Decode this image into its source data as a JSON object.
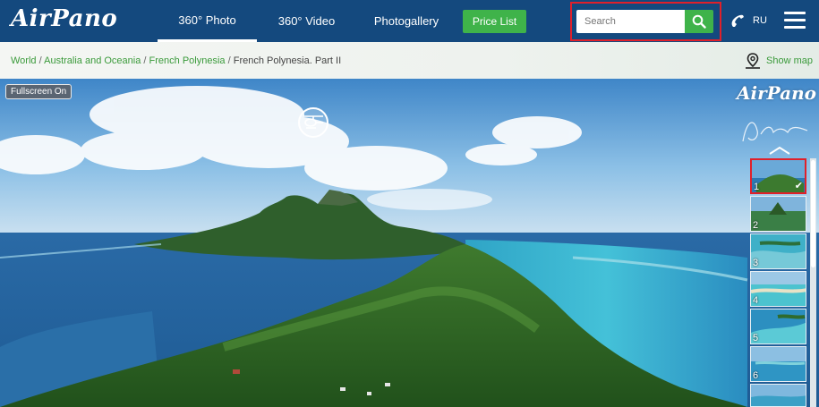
{
  "header": {
    "logo_text": "AirPano",
    "nav": [
      {
        "label": "360° Photo"
      },
      {
        "label": "360° Video"
      },
      {
        "label": "Photogallery"
      }
    ],
    "price_list_label": "Price List",
    "search": {
      "placeholder": "Search",
      "value": ""
    },
    "language": "RU"
  },
  "breadcrumb": {
    "items": [
      {
        "label": "World"
      },
      {
        "label": "Australia and Oceania"
      },
      {
        "label": "French Polynesia"
      },
      {
        "label": "French Polynesia. Part II"
      }
    ],
    "separator": "/",
    "show_map_label": "Show map"
  },
  "panorama": {
    "fullscreen_label": "Fullscreen On",
    "logo_text": "AirPano",
    "thumbnails": [
      {
        "num": "1",
        "active": true
      },
      {
        "num": "2",
        "active": false
      },
      {
        "num": "3",
        "active": false
      },
      {
        "num": "4",
        "active": false
      },
      {
        "num": "5",
        "active": false
      },
      {
        "num": "6",
        "active": false
      }
    ]
  },
  "colors": {
    "header_bg": "#14497e",
    "accent_green": "#3fb34a",
    "link_green": "#3a9a3a",
    "highlight_red": "#e0202a"
  }
}
